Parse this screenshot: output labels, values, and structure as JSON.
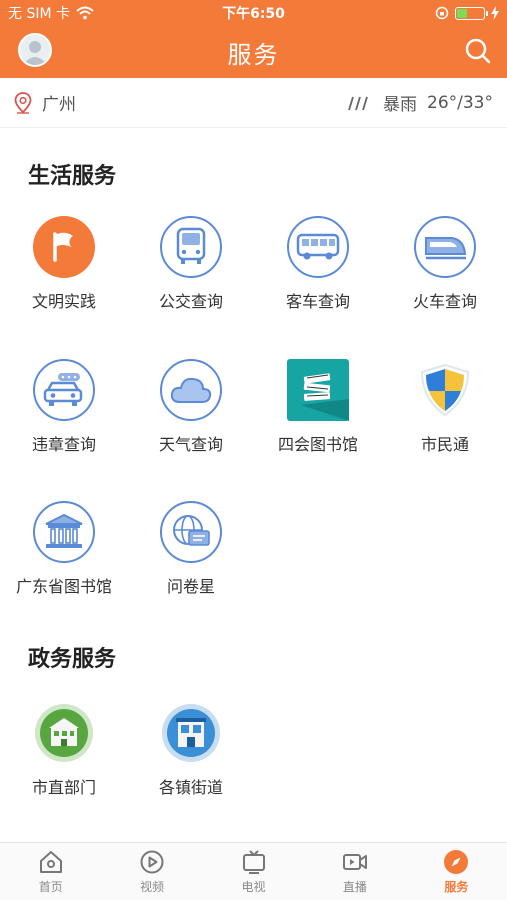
{
  "status": {
    "carrier": "无 SIM 卡",
    "time": "下午6:50"
  },
  "header": {
    "title": "服务"
  },
  "location": {
    "city": "广州",
    "weather": "暴雨",
    "temperature": "26°/33°"
  },
  "life_services": {
    "title": "生活服务",
    "items": [
      {
        "label": "文明实践",
        "icon": "flag-icon"
      },
      {
        "label": "公交查询",
        "icon": "bus-front-icon"
      },
      {
        "label": "客车查询",
        "icon": "coach-bus-icon"
      },
      {
        "label": "火车查询",
        "icon": "train-icon"
      },
      {
        "label": "违章查询",
        "icon": "car-icon"
      },
      {
        "label": "天气查询",
        "icon": "cloud-icon"
      },
      {
        "label": "四会图书馆",
        "icon": "books-icon"
      },
      {
        "label": "市民通",
        "icon": "shield-icon"
      },
      {
        "label": "广东省图书馆",
        "icon": "library-building-icon"
      },
      {
        "label": "问卷星",
        "icon": "globe-chat-icon"
      }
    ]
  },
  "gov_services": {
    "title": "政务服务",
    "items": [
      {
        "label": "市直部门",
        "icon": "green-building-icon"
      },
      {
        "label": "各镇街道",
        "icon": "blue-building-icon"
      }
    ]
  },
  "tabbar": {
    "items": [
      {
        "label": "首页",
        "icon": "home-icon"
      },
      {
        "label": "视频",
        "icon": "play-icon"
      },
      {
        "label": "电视",
        "icon": "tv-icon"
      },
      {
        "label": "直播",
        "icon": "live-camera-icon"
      },
      {
        "label": "服务",
        "icon": "compass-icon",
        "active": true
      }
    ]
  },
  "colors": {
    "brand": "#f47a3a",
    "icon_blue": "#5b8bd6"
  }
}
